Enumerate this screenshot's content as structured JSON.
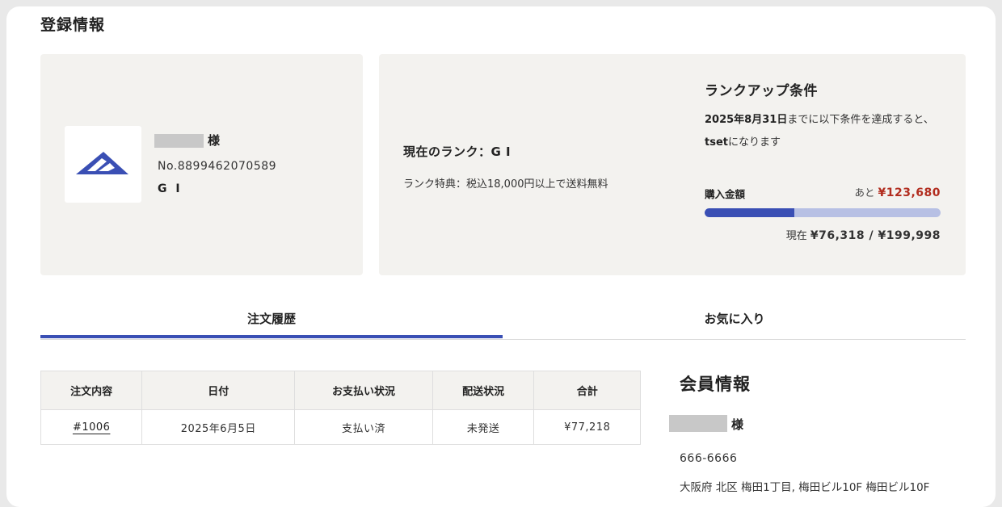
{
  "page": {
    "title": "登録情報"
  },
  "profile": {
    "honorific": "様",
    "member_no": "No.8899462070589",
    "rank": "G I",
    "logo_color": "#3a4fb4"
  },
  "rank": {
    "current_label": "現在のランク：G I",
    "benefit": "ランク特典：税込18,000円以上で送料無料"
  },
  "rankup": {
    "title": "ランクアップ条件",
    "deadline": "2025年8月31日",
    "condition_text": "までに以下条件を達成すると、",
    "target_name": "tset",
    "target_suffix": "になります",
    "amount_label": "購入金額",
    "remaining_prefix": "あと",
    "remaining_amount": "¥123,680",
    "current_prefix": "現在",
    "current_amount": "¥76,318 / ¥199,998",
    "progress_fraction": 0.3816,
    "progress_color": "#3a4fb4",
    "progress_track_color": "#b7c0e4",
    "remaining_color": "#b22d1f"
  },
  "tabs": [
    {
      "label": "注文履歴",
      "active": true
    },
    {
      "label": "お気に入り",
      "active": false
    }
  ],
  "orders": {
    "columns": [
      "注文内容",
      "日付",
      "お支払い状況",
      "配送状況",
      "合計"
    ],
    "rows": [
      {
        "order": "#1006",
        "date": "2025年6月5日",
        "payment": "支払い済",
        "shipping": "未発送",
        "total": "¥77,218"
      }
    ]
  },
  "member": {
    "title": "会員情報",
    "honorific": "様",
    "zip": "666-6666",
    "address": "大阪府 北区 梅田1丁目, 梅田ビル10F 梅田ビル10F"
  }
}
